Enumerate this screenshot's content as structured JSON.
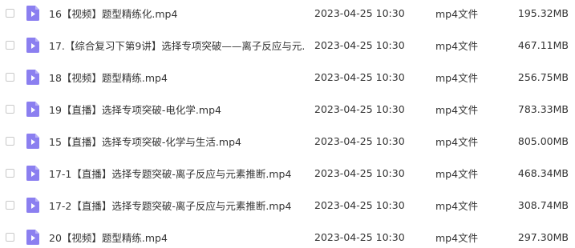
{
  "colors": {
    "icon_fill": "#8b7ff0",
    "icon_fold": "#b9b1f7",
    "text": "#333333",
    "checkbox_border": "#c8c8c8"
  },
  "rows": [
    {
      "icon": "video-file-icon",
      "name": "16【视频】题型精练化.mp4",
      "date": "2023-04-25 10:30",
      "type": "mp4文件",
      "size": "195.32MB"
    },
    {
      "icon": "video-file-icon",
      "name": "17.【综合复习下第9讲】选择专项突破——离子反应与元...",
      "date": "2023-04-25 10:30",
      "type": "mp4文件",
      "size": "467.11MB"
    },
    {
      "icon": "video-file-icon",
      "name": "18【视频】题型精练.mp4",
      "date": "2023-04-25 10:30",
      "type": "mp4文件",
      "size": "256.75MB"
    },
    {
      "icon": "video-file-icon",
      "name": "19【直播】选择专项突破-电化学.mp4",
      "date": "2023-04-25 10:30",
      "type": "mp4文件",
      "size": "783.33MB"
    },
    {
      "icon": "video-file-icon",
      "name": "15【直播】选择专项突破-化学与生活.mp4",
      "date": "2023-04-25 10:30",
      "type": "mp4文件",
      "size": "805.00MB"
    },
    {
      "icon": "video-file-icon",
      "name": "17-1【直播】选择专题突破-离子反应与元素推断.mp4",
      "date": "2023-04-25 10:30",
      "type": "mp4文件",
      "size": "468.34MB"
    },
    {
      "icon": "video-file-icon",
      "name": "17-2【直播】选择专题突破-离子反应与元素推断.mp4",
      "date": "2023-04-25 10:30",
      "type": "mp4文件",
      "size": "308.74MB"
    },
    {
      "icon": "video-file-icon",
      "name": "20【视频】题型精练.mp4",
      "date": "2023-04-25 10:30",
      "type": "mp4文件",
      "size": "297.30MB"
    }
  ]
}
